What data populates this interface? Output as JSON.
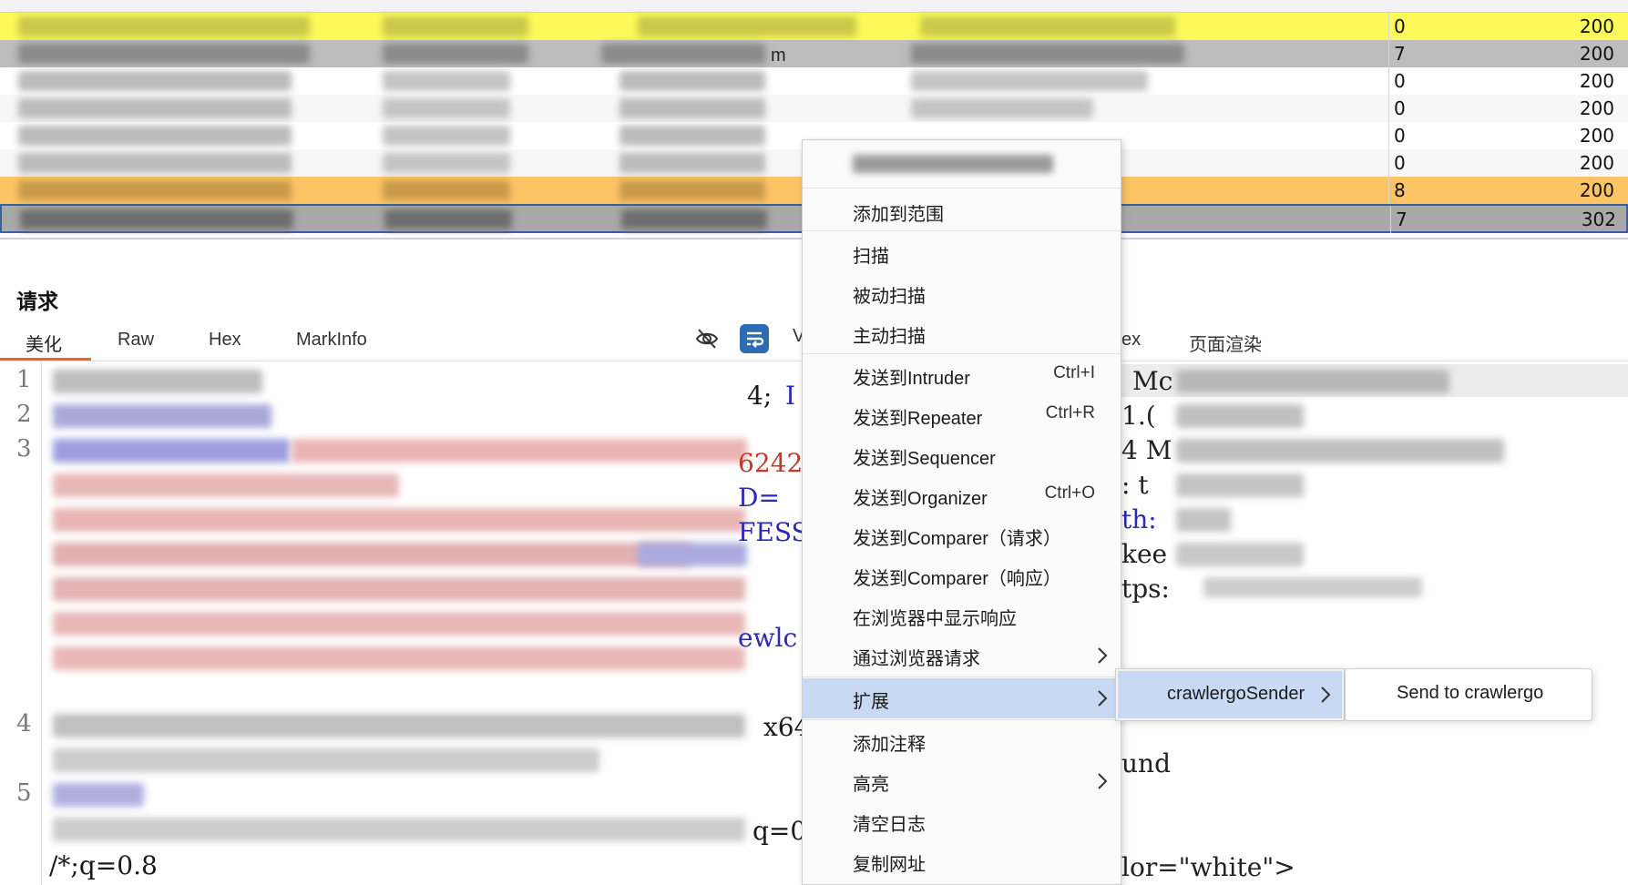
{
  "history": {
    "rows": [
      {
        "length": "0",
        "status": "200",
        "style": "yellow"
      },
      {
        "length": "7",
        "status": "200",
        "style": "gray",
        "tail": "m"
      },
      {
        "length": "0",
        "status": "200",
        "style": "white"
      },
      {
        "length": "0",
        "status": "200",
        "style": "alt"
      },
      {
        "length": "0",
        "status": "200",
        "style": "white"
      },
      {
        "length": "0",
        "status": "200",
        "style": "alt"
      },
      {
        "length": "8",
        "status": "200",
        "style": "orange"
      },
      {
        "length": "7",
        "status": "302",
        "style": "selected"
      }
    ]
  },
  "request_panel": {
    "title": "请求",
    "tabs": [
      "美化",
      "Raw",
      "Hex",
      "MarkInfo"
    ],
    "toolbar_partial": "V",
    "line_numbers": [
      "1",
      "2",
      "3",
      "4",
      "5"
    ],
    "visible_fragments": [
      "4;",
      "I",
      "6242",
      "D=",
      "FESS",
      "ewlc",
      "x64",
      "q=0.",
      "/*;q=0.8"
    ]
  },
  "response_panel": {
    "tabs_partial": [
      "ex",
      "页面渲染"
    ],
    "visible_fragments": [
      "Mc",
      "1.(",
      "4 M",
      ": t",
      "th:",
      "kee",
      "tps:",
      "und",
      "lor=\"white\">"
    ]
  },
  "context_menu": {
    "header_blur": true,
    "items": [
      {
        "label": "添加到范围"
      },
      {
        "label": "扫描"
      },
      {
        "label": "被动扫描"
      },
      {
        "label": "主动扫描"
      },
      {
        "label": "发送到Intruder",
        "shortcut": "Ctrl+I"
      },
      {
        "label": "发送到Repeater",
        "shortcut": "Ctrl+R"
      },
      {
        "label": "发送到Sequencer"
      },
      {
        "label": "发送到Organizer",
        "shortcut": "Ctrl+O"
      },
      {
        "label": "发送到Comparer（请求）"
      },
      {
        "label": "发送到Comparer（响应）"
      },
      {
        "label": "在浏览器中显示响应"
      },
      {
        "label": "通过浏览器请求"
      },
      {
        "label": "扩展"
      },
      {
        "label": "添加注释"
      },
      {
        "label": "高亮"
      },
      {
        "label": "清空日志"
      },
      {
        "label": "复制网址"
      }
    ],
    "submenu": {
      "label": "crawlergoSender"
    },
    "submenu2": {
      "label": "Send to crawlergo"
    }
  },
  "colors": {
    "accent_tab": "#e8652b",
    "menu_hover": "#c8daf3",
    "row_yellow": "#fbfa5a",
    "row_orange": "#fdc466",
    "wrap_button": "#2d6bb5"
  }
}
